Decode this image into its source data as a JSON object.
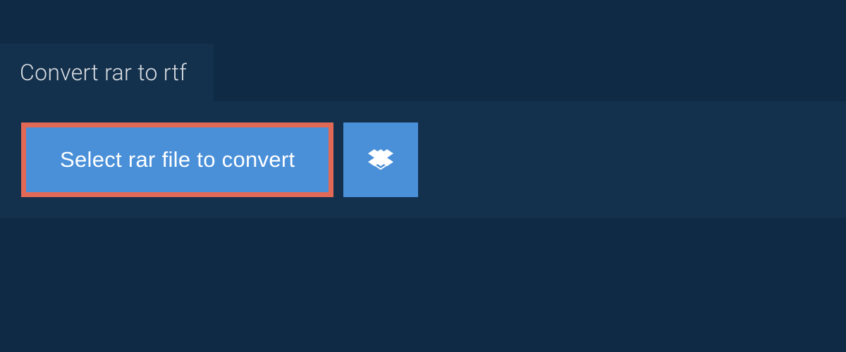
{
  "tab": {
    "title": "Convert rar to rtf"
  },
  "actions": {
    "select_file_label": "Select rar file to convert",
    "dropbox_icon_name": "dropbox"
  },
  "colors": {
    "background": "#0f2a44",
    "panel": "#13304d",
    "button": "#4a90d9",
    "highlight_border": "#e36957",
    "text_light": "#d9dde0",
    "text_white": "#ffffff"
  }
}
